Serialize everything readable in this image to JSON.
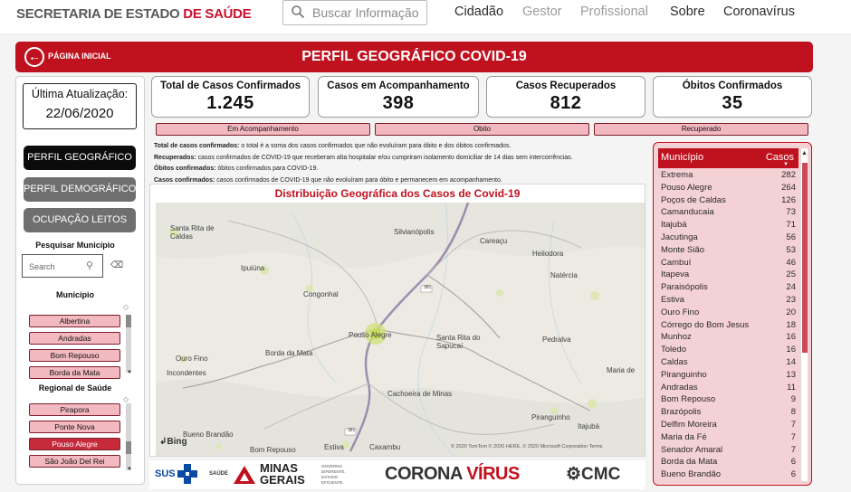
{
  "topbar": {
    "brand_prefix": "SECRETARIA DE ESTADO ",
    "brand_highlight": "DE SAÚDE",
    "search_placeholder": "Buscar Informação",
    "nav": [
      "Cidadão",
      "Gestor",
      "Profissional",
      "Sobre",
      "Coronavírus"
    ]
  },
  "header": {
    "back_label": "PÁGINA INICIAL",
    "title": "PERFIL GEOGRÁFICO COVID-19"
  },
  "sidebar": {
    "update_label": "Última Atualização:",
    "update_date": "22/06/2020",
    "buttons": [
      "PERFIL GEOGRÁFICO",
      "PERFIL DEMOGRÁFICO",
      "OCUPAÇÃO LEITOS"
    ],
    "search_label": "Pesquisar Município",
    "search_placeholder": "Search",
    "municipio_label": "Município",
    "municipios": [
      "Albertina",
      "Andradas",
      "Bom Repouso",
      "Borda da Mata"
    ],
    "regional_label": "Regional de Saúde",
    "regionais": [
      "Pirapora",
      "Ponte Nova",
      "Pouso Alegre",
      "São João Del Rei"
    ],
    "regional_selected": "Pouso Alegre"
  },
  "kpis": [
    {
      "title": "Total de Casos Confirmados",
      "value": "1.245"
    },
    {
      "title": "Casos em Acompanhamento",
      "value": "398"
    },
    {
      "title": "Casos Recuperados",
      "value": "812"
    },
    {
      "title": "Óbitos Confirmados",
      "value": "35"
    }
  ],
  "filters": [
    "Em Acompanhamento",
    "Obito",
    "Recuperado"
  ],
  "definitions": [
    {
      "term": "Total de  casos confirmados:",
      "text": " o total é a soma dos casos confirmados que não evoluíram para óbito e  dos óbitos confirmados."
    },
    {
      "term": "Recuperados:",
      "text": " casos confirmados de COVID-19 que receberam alta hospitalar e/ou cumpriram isolamento domiciliar de 14 dias sem intercorrências."
    },
    {
      "term": "Óbitos confirmados:",
      "text": " óbitos confirmados para COVID-19."
    },
    {
      "term": "Casos confirmados:",
      "text": " casos confirmados de COVID-19 que  não evoluíram para óbito e permanecem em acompanhamento."
    }
  ],
  "map": {
    "title": "Distribuição Geográfica dos Casos de Covid-19",
    "places": [
      "Santa Rita de Caldas",
      "Silvianópolis",
      "Careaçu",
      "Heliodora",
      "Ipuiúna",
      "Natércia",
      "Congonhal",
      "Pouso Alegre",
      "Santa Rita do Sapucaí",
      "Pedralva",
      "Ouro Fino",
      "Borda da Mata",
      "Maria de",
      "Incondentes",
      "Cachoeira de Minas",
      "Piranguinho",
      "Itajubá",
      "Bueno Brandão",
      "Bom Repouso",
      "Estiva",
      "Caxambu"
    ],
    "road_labels": [
      "381",
      "381"
    ],
    "copyright": "© 2020 TomTom © 2020 HERE, © 2020 Microsoft Corporation Terms",
    "provider": "Bing"
  },
  "table": {
    "col_municipio": "Município",
    "col_casos": "Casos",
    "rows": [
      {
        "municipio": "Extrema",
        "casos": "282"
      },
      {
        "municipio": "Pouso Alegre",
        "casos": "264"
      },
      {
        "municipio": "Poços de Caldas",
        "casos": "126"
      },
      {
        "municipio": "Camanducaia",
        "casos": "73"
      },
      {
        "municipio": "Itajubá",
        "casos": "71"
      },
      {
        "municipio": "Jacutinga",
        "casos": "56"
      },
      {
        "municipio": "Monte Sião",
        "casos": "53"
      },
      {
        "municipio": "Cambuí",
        "casos": "46"
      },
      {
        "municipio": "Itapeva",
        "casos": "25"
      },
      {
        "municipio": "Paraisópolis",
        "casos": "24"
      },
      {
        "municipio": "Estiva",
        "casos": "23"
      },
      {
        "municipio": "Ouro Fino",
        "casos": "20"
      },
      {
        "municipio": "Córrego do Bom Jesus",
        "casos": "18"
      },
      {
        "municipio": "Munhoz",
        "casos": "16"
      },
      {
        "municipio": "Toledo",
        "casos": "16"
      },
      {
        "municipio": "Caldas",
        "casos": "14"
      },
      {
        "municipio": "Piranguinho",
        "casos": "13"
      },
      {
        "municipio": "Andradas",
        "casos": "11"
      },
      {
        "municipio": "Bom Repouso",
        "casos": "9"
      },
      {
        "municipio": "Brazópolis",
        "casos": "8"
      },
      {
        "municipio": "Delfim Moreira",
        "casos": "7"
      },
      {
        "municipio": "Maria da Fé",
        "casos": "7"
      },
      {
        "municipio": "Senador Amaral",
        "casos": "7"
      },
      {
        "municipio": "Borda da Mata",
        "casos": "6"
      },
      {
        "municipio": "Bueno Brandão",
        "casos": "6"
      }
    ]
  },
  "footer": {
    "sus": "SUS",
    "saude": "SAÚDE",
    "minas_line1": "MINAS",
    "minas_line2": "GERAIS",
    "gov_text": "GOVERNO DIFERENTE. ESTADO EFICIENTE.",
    "corona_left": "CORONA",
    "corona_right": "VÍRUS",
    "cmc": "CMC"
  },
  "colors": {
    "brand_red": "#c0111f",
    "chip_pink": "#f2b9c0",
    "table_pink": "#f4d1d5"
  }
}
